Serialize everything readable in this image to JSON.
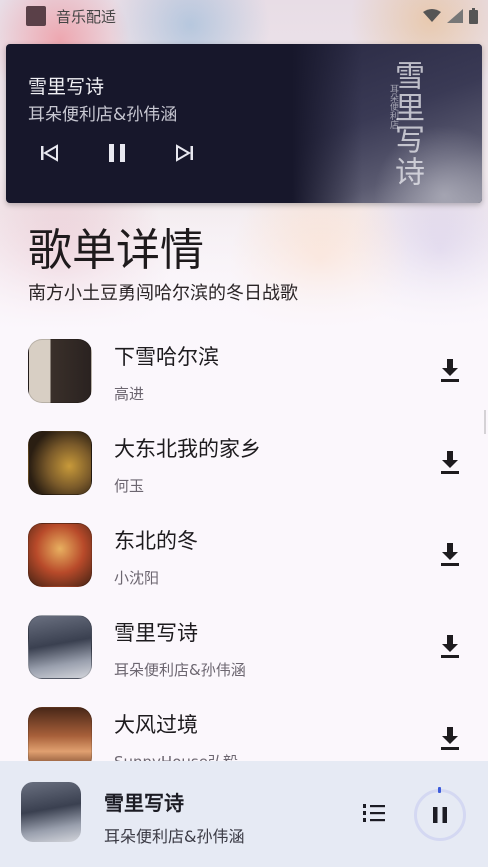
{
  "status_bar": {
    "app_title": "音乐配适"
  },
  "now_playing": {
    "title": "雪里写诗",
    "artist": "耳朵便利店&孙伟涵",
    "art_text": "雪里写诗",
    "art_small": "耳朵便利店"
  },
  "page": {
    "title": "歌单详情",
    "subtitle": "南方小土豆勇闯哈尔滨的冬日战歌"
  },
  "songs": [
    {
      "title": "下雪哈尔滨",
      "artist": "高进",
      "cover_colors": [
        "#d8d0c8",
        "#2c2420"
      ]
    },
    {
      "title": "大东北我的家乡",
      "artist": "何玉",
      "cover_colors": [
        "#3a2a18",
        "#c89a3a"
      ]
    },
    {
      "title": "东北的冬",
      "artist": "小沈阳",
      "cover_colors": [
        "#8a2a1a",
        "#d8a050"
      ]
    },
    {
      "title": "雪里写诗",
      "artist": "耳朵便利店&孙伟涵",
      "cover_colors": [
        "#4a5060",
        "#c8ccd4"
      ]
    },
    {
      "title": "大风过境",
      "artist": "SunnyHouse弘毅",
      "cover_colors": [
        "#5a3020",
        "#d89060"
      ]
    }
  ],
  "bottom_player": {
    "title": "雪里写诗",
    "artist": "耳朵便利店&孙伟涵"
  },
  "colors": {
    "accent": "#3b5bdb",
    "card_bg": "#17172b",
    "bottom_bg": "#e6eaf4"
  }
}
